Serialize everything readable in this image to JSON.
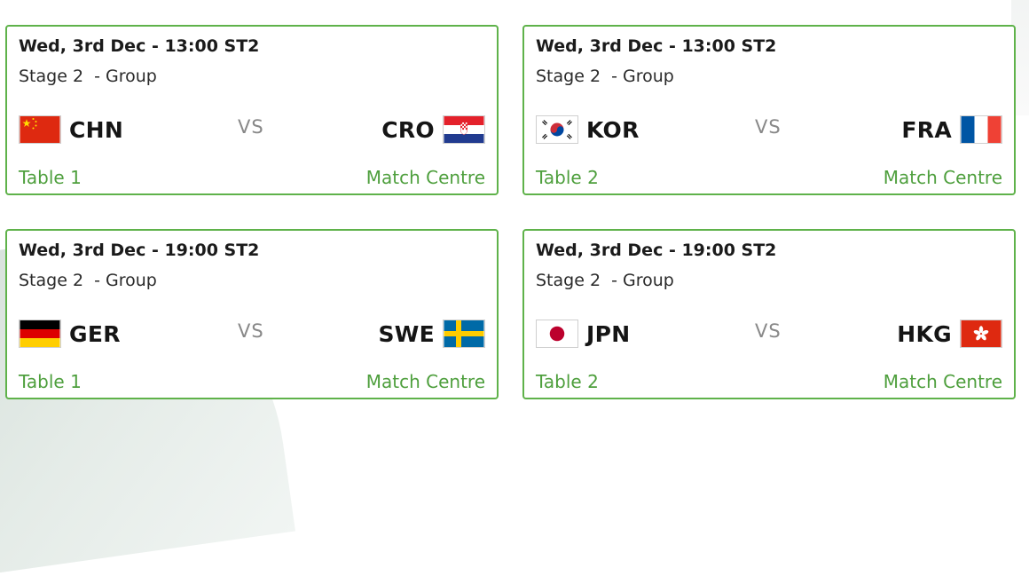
{
  "matches": [
    {
      "date": "Wed, 3rd Dec - 13:00 ST2",
      "stage": "Stage 2  - Group",
      "home": {
        "code": "CHN",
        "flag": "china-flag-icon"
      },
      "vs": "VS",
      "away": {
        "code": "CRO",
        "flag": "croatia-flag-icon"
      },
      "venue": "Table 1",
      "link": "Match Centre"
    },
    {
      "date": "Wed, 3rd Dec - 13:00 ST2",
      "stage": "Stage 2  - Group",
      "home": {
        "code": "KOR",
        "flag": "south-korea-flag-icon"
      },
      "vs": "VS",
      "away": {
        "code": "FRA",
        "flag": "france-flag-icon"
      },
      "venue": "Table 2",
      "link": "Match Centre"
    },
    {
      "date": "Wed, 3rd Dec - 19:00 ST2",
      "stage": "Stage 2  - Group",
      "home": {
        "code": "GER",
        "flag": "germany-flag-icon"
      },
      "vs": "VS",
      "away": {
        "code": "SWE",
        "flag": "sweden-flag-icon"
      },
      "venue": "Table 1",
      "link": "Match Centre"
    },
    {
      "date": "Wed, 3rd Dec - 19:00 ST2",
      "stage": "Stage 2  - Group",
      "home": {
        "code": "JPN",
        "flag": "japan-flag-icon"
      },
      "vs": "VS",
      "away": {
        "code": "HKG",
        "flag": "hong-kong-flag-icon"
      },
      "venue": "Table 2",
      "link": "Match Centre"
    }
  ],
  "colors": {
    "accent_green": "#4e9f3d",
    "card_border": "#5fb24a",
    "vs_gray": "#888888"
  }
}
